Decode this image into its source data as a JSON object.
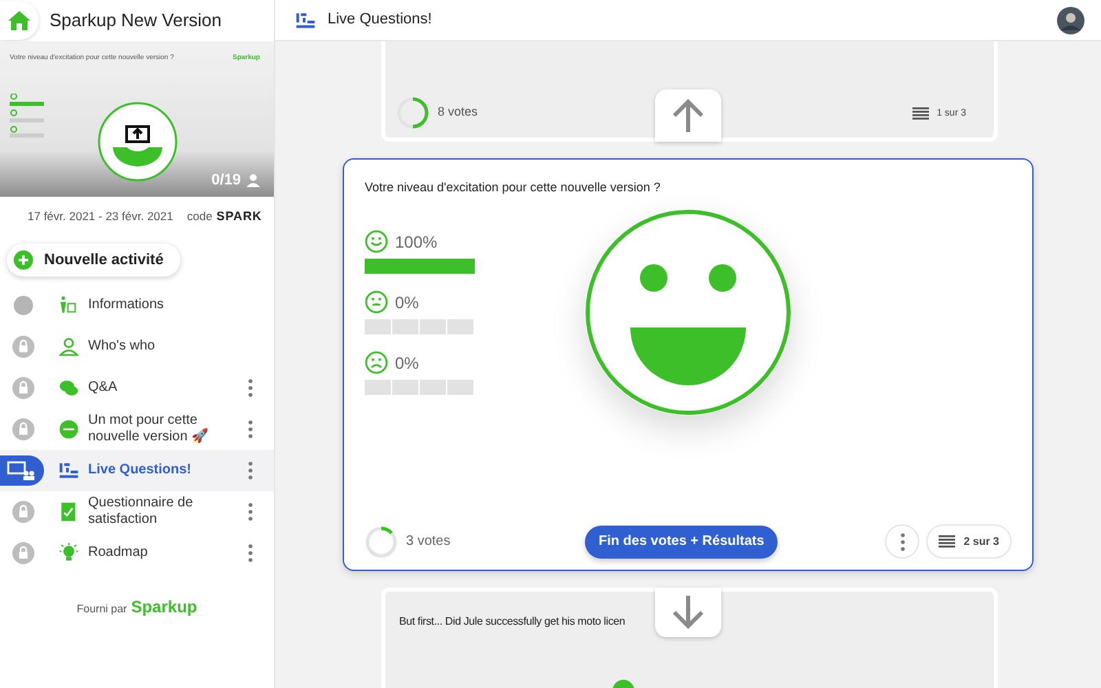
{
  "sidebar": {
    "title": "Sparkup New Version",
    "preview": {
      "question": "Votre niveau d'excitation pour cette nouvelle version ?",
      "brand": "Sparkup",
      "count": "0/19"
    },
    "dates": "17 févr. 2021 - 23 févr. 2021",
    "code_label": "code",
    "code": "SPARK",
    "new_button": "Nouvelle activité",
    "items": [
      {
        "label": "Informations",
        "kind": "dot",
        "menu": false,
        "selected": false
      },
      {
        "label": "Who's who",
        "kind": "lock",
        "menu": false,
        "selected": false
      },
      {
        "label": "Q&A",
        "kind": "lock",
        "menu": true,
        "selected": false
      },
      {
        "label": "Un mot pour cette nouvelle version 🚀",
        "kind": "lock",
        "menu": true,
        "selected": false
      },
      {
        "label": "Live Questions!",
        "kind": "live",
        "menu": true,
        "selected": true
      },
      {
        "label": "Questionnaire de satisfaction",
        "kind": "lock",
        "menu": true,
        "selected": false
      },
      {
        "label": "Roadmap",
        "kind": "lock",
        "menu": true,
        "selected": false
      }
    ],
    "footer_text": "Fourni par",
    "footer_brand": "Sparkup"
  },
  "header": {
    "title": "Live Questions!"
  },
  "previous_card": {
    "votes": "8 votes",
    "position": "1 sur 3"
  },
  "current_card": {
    "question": "Votre niveau d'excitation pour cette nouvelle version ?",
    "results": [
      {
        "kind": "happy",
        "percent": "100%",
        "level": 1
      },
      {
        "kind": "neutral",
        "percent": "0%",
        "level": 0
      },
      {
        "kind": "sad",
        "percent": "0%",
        "level": 0
      }
    ],
    "votes": "3 votes",
    "end_button": "Fin des votes + Résultats",
    "position": "2 sur 3"
  },
  "next_card": {
    "question": "But first... Did Jule successfully get his moto licen"
  }
}
